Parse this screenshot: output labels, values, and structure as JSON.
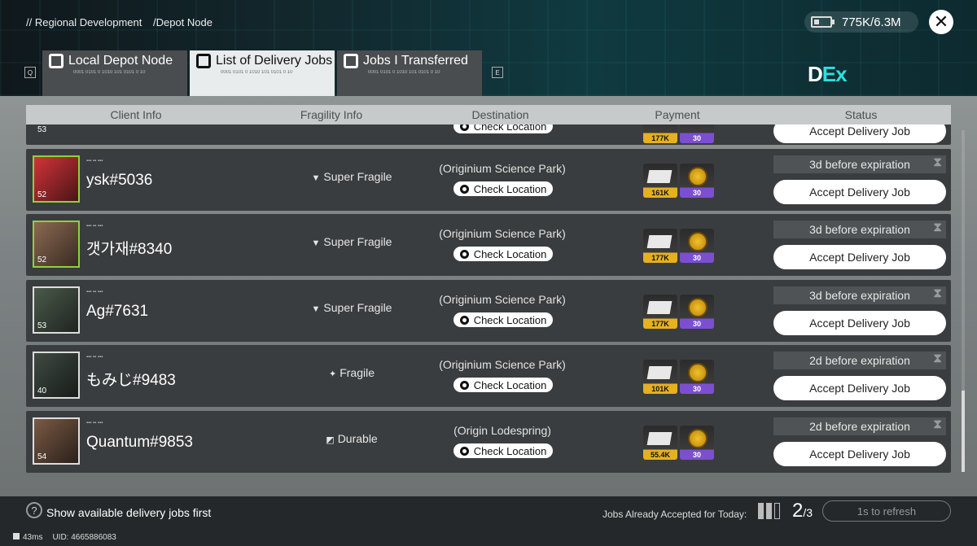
{
  "header": {
    "breadcrumb": [
      "// Regional Development",
      "/Depot Node"
    ],
    "sanity": "775K/6.3M",
    "close_label": "✕",
    "brand_main": "D",
    "brand_ex": "Ex"
  },
  "tabs": [
    {
      "label": "Local Depot Node",
      "sub": "0001 0101 0 1010 101 0101 0 10",
      "key": "Q"
    },
    {
      "label": "List of Delivery Jobs",
      "sub": "0001 0101 0 1010 101 0101 0 10",
      "active": true
    },
    {
      "label": "Jobs I Transferred",
      "sub": "0001 0101 0 1010 101 0101 0 10",
      "key": "E"
    }
  ],
  "columns": [
    "Client Info",
    "Fragility Info",
    "Destination",
    "Payment",
    "Status"
  ],
  "partial_row": {
    "level": "53",
    "check_label": "Check Location",
    "pay1": "177K",
    "pay2": "30",
    "accept": "Accept Delivery Job"
  },
  "rows": [
    {
      "name": "ysk#5036",
      "level": "52",
      "fragility": "Super Fragile",
      "destination": "(Originium Science Park)",
      "check_label": "Check Location",
      "pay1": "161K",
      "pay2": "30",
      "expiry": "3d before expiration",
      "accept": "Accept Delivery Job"
    },
    {
      "name": "갯가재#8340",
      "level": "52",
      "fragility": "Super Fragile",
      "destination": "(Originium Science Park)",
      "check_label": "Check Location",
      "pay1": "177K",
      "pay2": "30",
      "expiry": "3d before expiration",
      "accept": "Accept Delivery Job"
    },
    {
      "name": "Ag#7631",
      "level": "53",
      "fragility": "Super Fragile",
      "destination": "(Originium Science Park)",
      "check_label": "Check Location",
      "pay1": "177K",
      "pay2": "30",
      "expiry": "3d before expiration",
      "accept": "Accept Delivery Job"
    },
    {
      "name": "もみじ#9483",
      "level": "40",
      "fragility": "Fragile",
      "destination": "(Originium Science Park)",
      "check_label": "Check Location",
      "pay1": "101K",
      "pay2": "30",
      "expiry": "2d before expiration",
      "accept": "Accept Delivery Job"
    },
    {
      "name": "Quantum#9853",
      "level": "54",
      "fragility": "Durable",
      "destination": "(Origin Lodespring)",
      "check_label": "Check Location",
      "pay1": "55.4K",
      "pay2": "30",
      "expiry": "2d before expiration",
      "accept": "Accept Delivery Job"
    }
  ],
  "footer": {
    "toggle_text": "Show available delivery jobs first",
    "accepted_label": "Jobs Already Accepted for Today:",
    "count_main": "2",
    "count_total": "/3",
    "refresh": "1s to refresh",
    "ping": "43ms",
    "uid": "UID: 4665886083"
  }
}
